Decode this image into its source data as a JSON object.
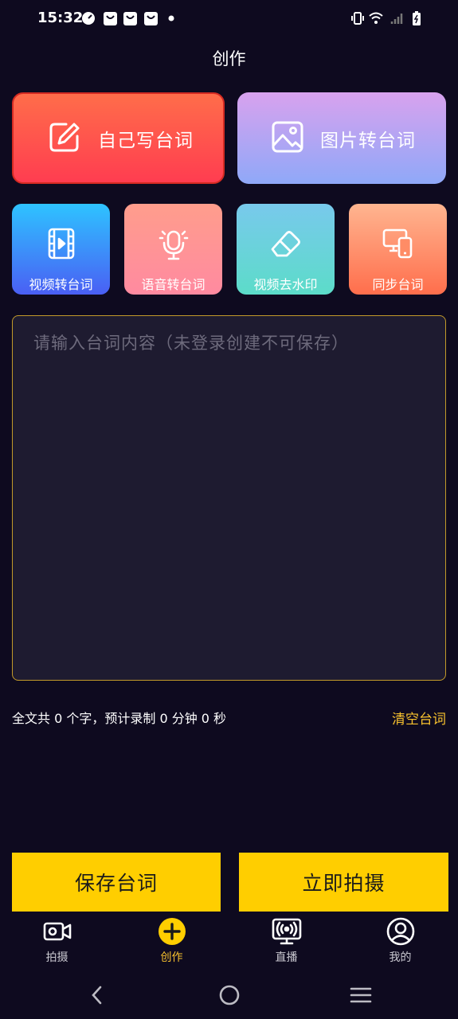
{
  "status_bar": {
    "time": "15:32"
  },
  "page": {
    "title": "创作"
  },
  "main_cards": [
    {
      "label": "自己写台词",
      "icon": "edit-note-icon"
    },
    {
      "label": "图片转台词",
      "icon": "image-icon"
    }
  ],
  "tools": [
    {
      "label": "视频转台词",
      "icon": "video-file-icon"
    },
    {
      "label": "语音转台词",
      "icon": "microphone-icon"
    },
    {
      "label": "视频去水印",
      "icon": "eraser-icon"
    },
    {
      "label": "同步台词",
      "icon": "devices-sync-icon"
    }
  ],
  "editor": {
    "placeholder": "请输入台词内容（未登录创建不可保存）",
    "value": "",
    "stats": "全文共 0 个字，预计录制 0 分钟 0 秒",
    "clear_label": "清空台词"
  },
  "actions": {
    "save_label": "保存台词",
    "shoot_label": "立即拍摄"
  },
  "tab_bar": {
    "items": [
      {
        "label": "拍摄",
        "icon": "video-camera-icon",
        "active": false
      },
      {
        "label": "创作",
        "icon": "plus-circle-icon",
        "active": true
      },
      {
        "label": "直播",
        "icon": "live-monitor-icon",
        "active": false
      },
      {
        "label": "我的",
        "icon": "user-icon",
        "active": false
      }
    ]
  },
  "colors": {
    "accent": "#ffce00",
    "background": "#0e0a1f",
    "active_tab": "#f7c12e"
  }
}
